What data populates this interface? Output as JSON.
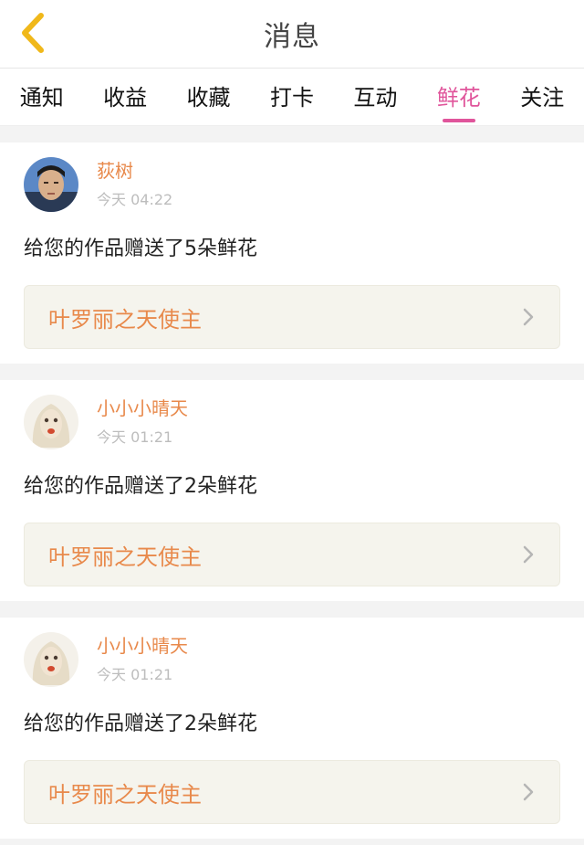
{
  "header": {
    "title": "消息",
    "back_icon": "chevron-left-icon"
  },
  "tabs": [
    {
      "label": "通知",
      "active": false
    },
    {
      "label": "收益",
      "active": false
    },
    {
      "label": "收藏",
      "active": false
    },
    {
      "label": "打卡",
      "active": false
    },
    {
      "label": "互动",
      "active": false
    },
    {
      "label": "鲜花",
      "active": true
    },
    {
      "label": "关注",
      "active": false
    }
  ],
  "messages": [
    {
      "user": "荻树",
      "time": "今天 04:22",
      "text": "给您的作品赠送了5朵鲜花",
      "work": "叶罗丽之天使主"
    },
    {
      "user": "小小小晴天",
      "time": "今天 01:21",
      "text": "给您的作品赠送了2朵鲜花",
      "work": "叶罗丽之天使主"
    },
    {
      "user": "小小小晴天",
      "time": "今天 01:21",
      "text": "给您的作品赠送了2朵鲜花",
      "work": "叶罗丽之天使主"
    }
  ],
  "colors": {
    "accent": "#e0559b",
    "name": "#e8894b",
    "back": "#f0b81a"
  }
}
